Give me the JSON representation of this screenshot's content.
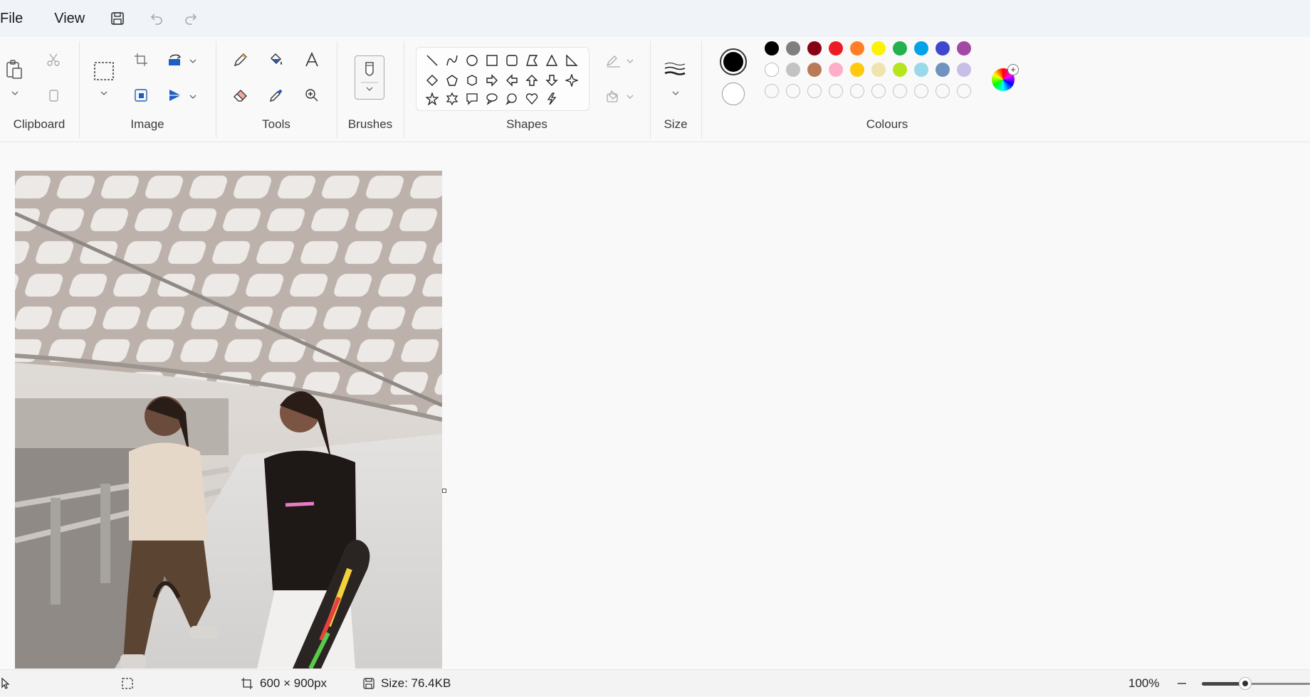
{
  "menu": {
    "file": "File",
    "view": "View"
  },
  "ribbon": {
    "groups": {
      "clipboard": "Clipboard",
      "image": "Image",
      "tools": "Tools",
      "brushes": "Brushes",
      "shapes": "Shapes",
      "size": "Size",
      "colours": "Colours"
    }
  },
  "colours": {
    "primary": "#000000",
    "secondary": "#ffffff",
    "row1": [
      "#000000",
      "#7f7f7f",
      "#880015",
      "#ed1c24",
      "#ff7f27",
      "#fff200",
      "#22b14c",
      "#00a2e8",
      "#3f48cc",
      "#a349a4"
    ],
    "row2": [
      "#ffffff",
      "#c3c3c3",
      "#b97a57",
      "#ffaec9",
      "#ffc90e",
      "#efe4b0",
      "#b5e61d",
      "#99d9ea",
      "#7092be",
      "#c8bfe7"
    ]
  },
  "canvas": {
    "image_description": "photo-of-two-women-walking-under-canopy"
  },
  "status": {
    "dimensions": "600 × 900px",
    "size": "Size: 76.4KB",
    "zoom": "100%",
    "zoom_level": 0.4
  }
}
